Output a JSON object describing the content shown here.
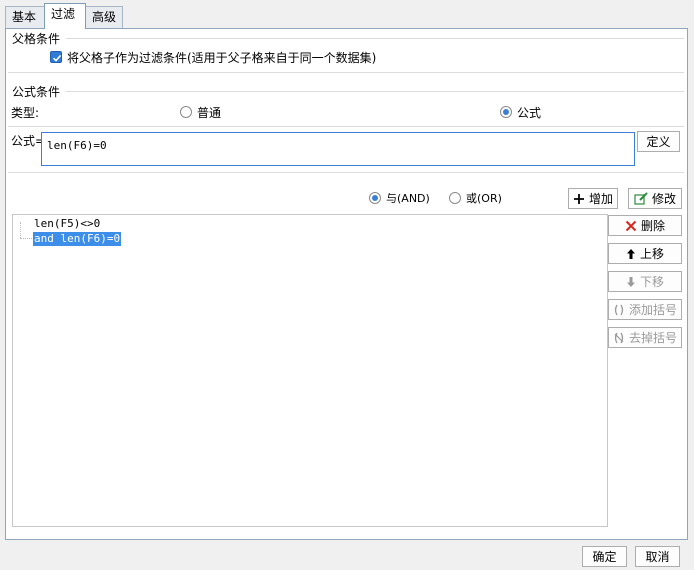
{
  "tabs": [
    "基本",
    "过滤",
    "高级"
  ],
  "parent_group": {
    "title": "父格条件",
    "checkbox_label": "将父格子作为过滤条件(适用于父子格来自于同一个数据集)",
    "checked": true
  },
  "formula_group": {
    "title": "公式条件",
    "type_label": "类型:",
    "type_normal": "普通",
    "type_formula": "公式",
    "selected_type": "公式",
    "formula_label": "公式=",
    "formula_value": "len(F6)=0",
    "define_button": "定义"
  },
  "logic": {
    "and_label": "与(AND)",
    "or_label": "或(OR)",
    "selected": "AND"
  },
  "actions": {
    "add": "增加",
    "modify": "修改",
    "delete": "删除",
    "move_up": "上移",
    "move_down": "下移",
    "add_bracket": "添加括号",
    "remove_bracket": "去掉括号"
  },
  "conditions": [
    {
      "text": "len(F5)<>0",
      "selected": false
    },
    {
      "text": "and len(F6)=0",
      "selected": true
    }
  ],
  "footer": {
    "ok": "确定",
    "cancel": "取消"
  },
  "colors": {
    "accent": "#3b7fd4",
    "selection": "#3d8ee8",
    "delete_red": "#d9261c"
  }
}
